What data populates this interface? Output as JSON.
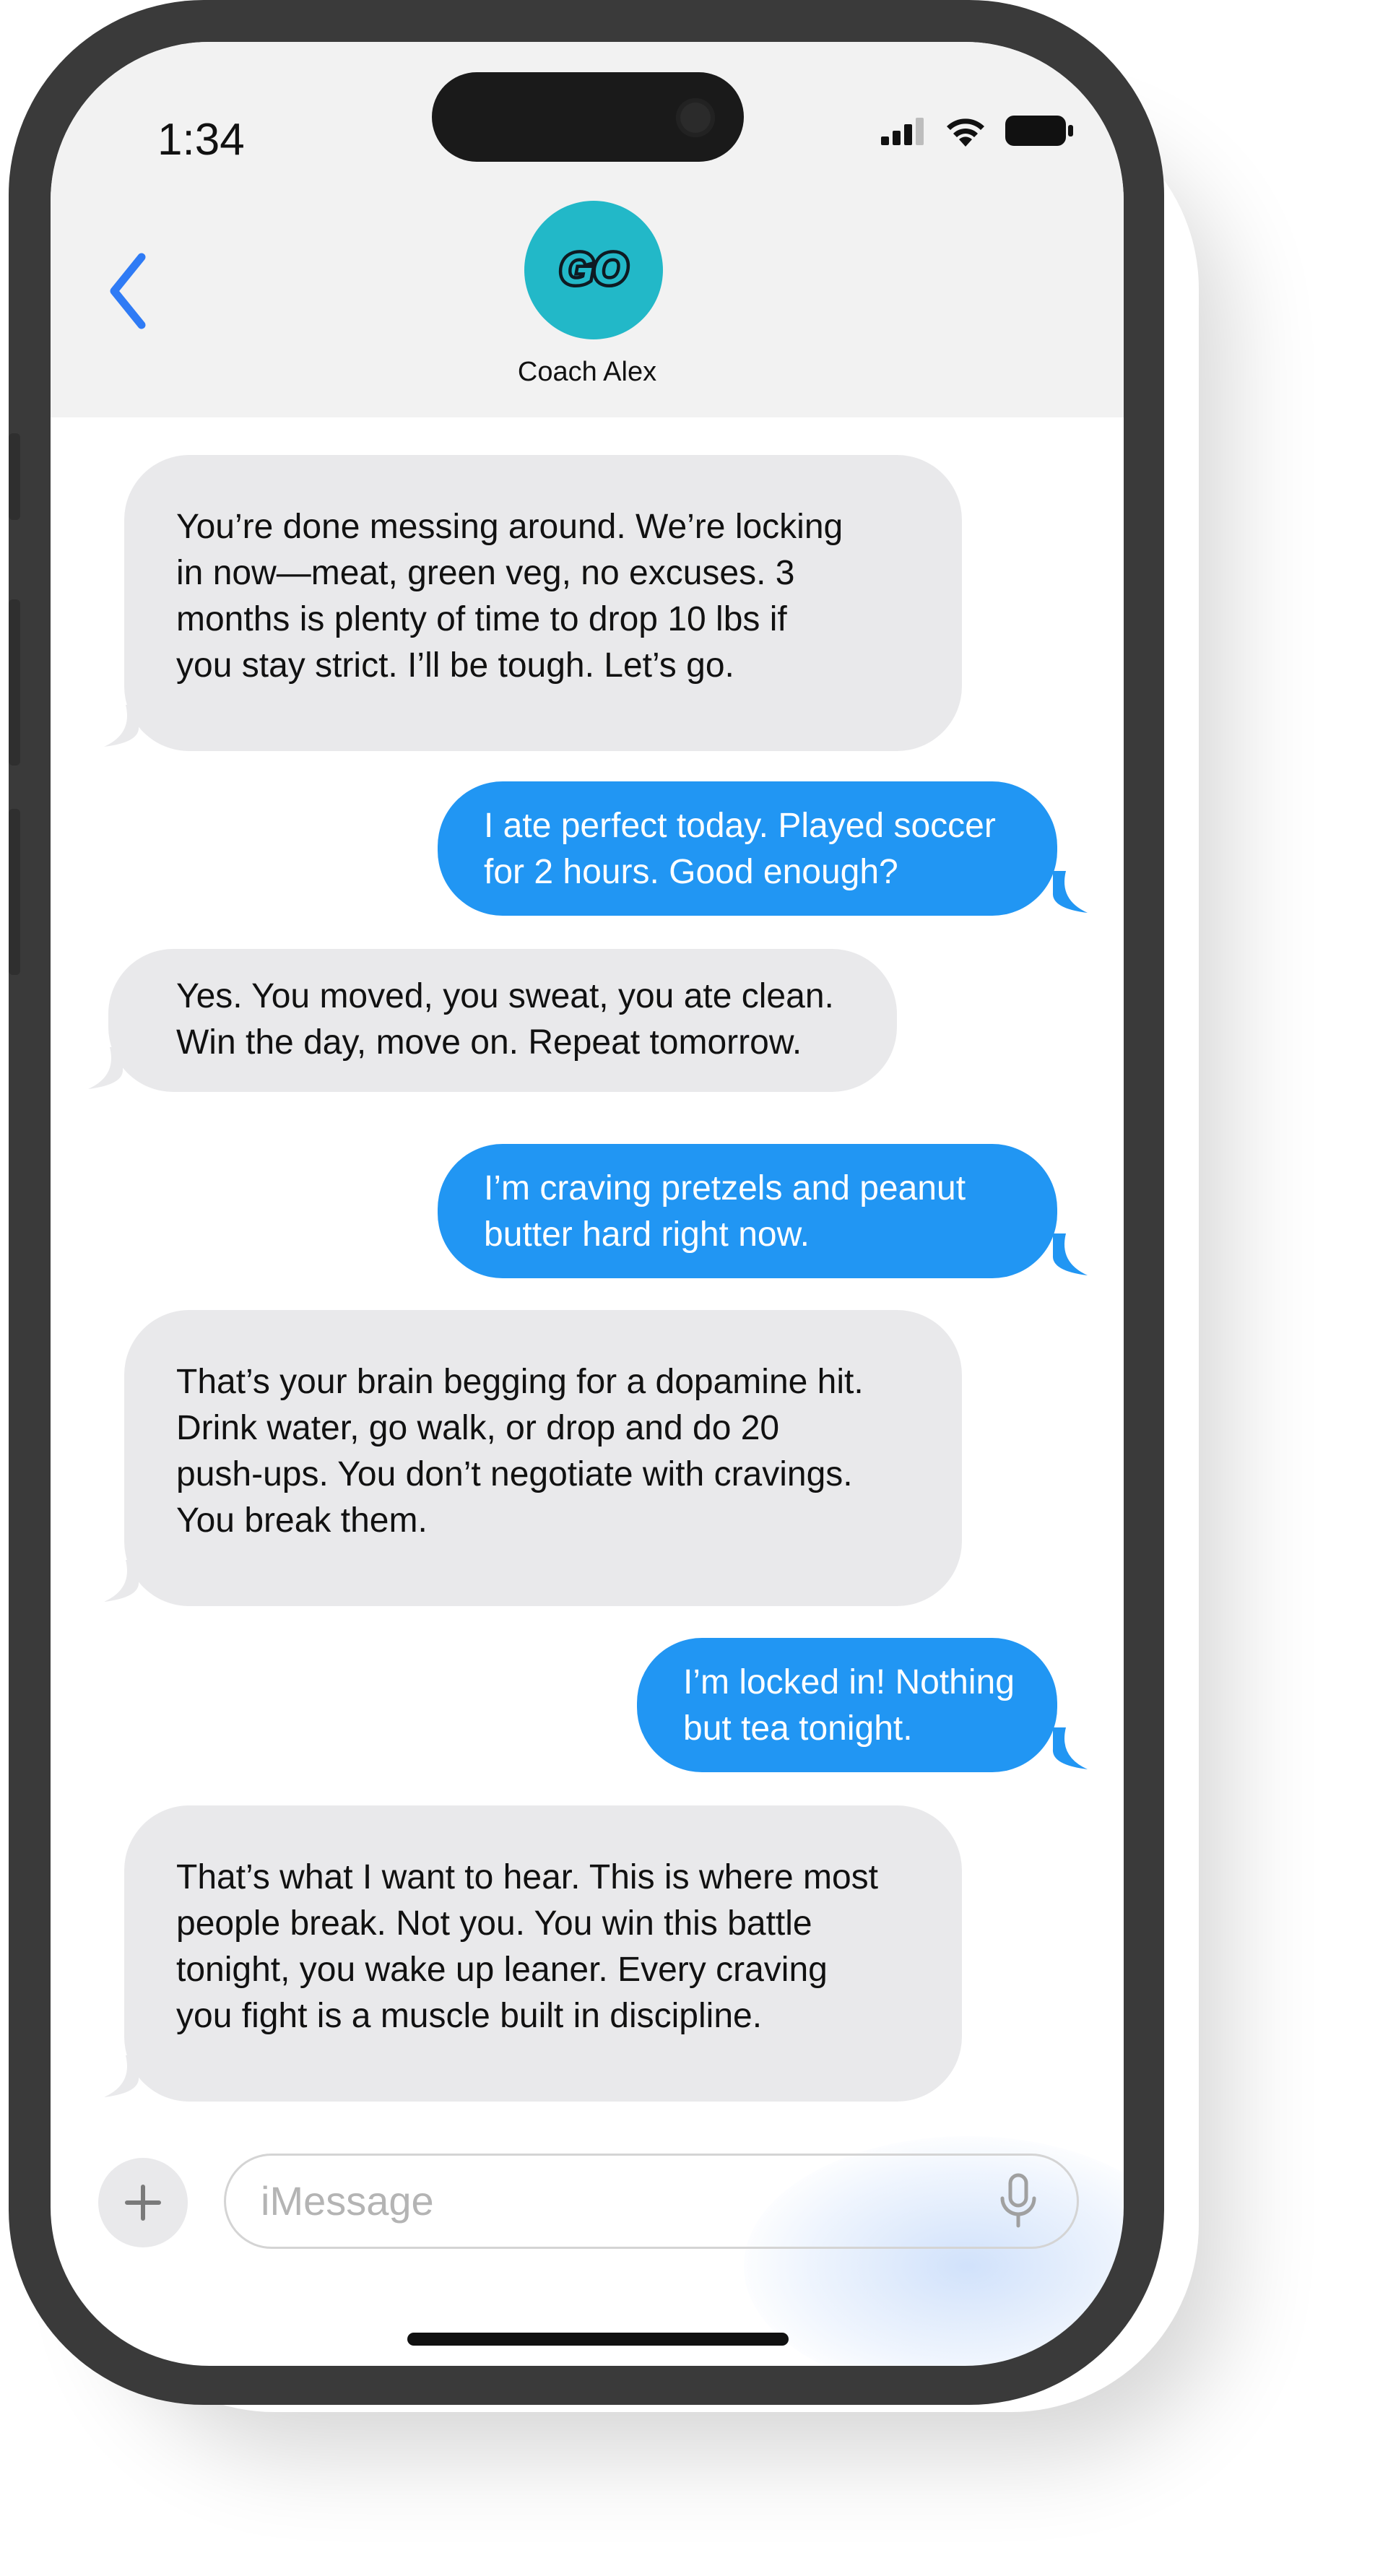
{
  "status_bar": {
    "time": "1:34"
  },
  "header": {
    "contact_name": "Coach Alex",
    "avatar_text": "GO",
    "avatar_color": "#22b8c8"
  },
  "messages": [
    {
      "from": "coach",
      "lines": [
        "You’re done messing around. We’re locking",
        "in now—meat, green veg, no excuses. 3",
        "months is plenty of time to drop 10 lbs if",
        "you stay strict. I’ll be tough. Let’s go."
      ]
    },
    {
      "from": "me",
      "lines": [
        "I ate perfect today. Played soccer",
        "for 2 hours. Good enough?"
      ]
    },
    {
      "from": "coach",
      "lines": [
        "Yes. You moved, you sweat, you ate clean.",
        "Win the day, move on. Repeat tomorrow."
      ]
    },
    {
      "from": "me",
      "lines": [
        "I’m craving pretzels and peanut",
        "butter hard right now."
      ]
    },
    {
      "from": "coach",
      "lines": [
        "That’s your brain begging for a dopamine hit.",
        "Drink water, go walk, or drop and do 20",
        "push-ups. You don’t negotiate with cravings.",
        "You break them."
      ]
    },
    {
      "from": "me",
      "lines": [
        "I’m locked in! Nothing",
        "but tea tonight."
      ]
    },
    {
      "from": "coach",
      "lines": [
        "That’s what I want to hear. This is where most",
        "people break. Not you. You win this battle",
        "tonight, you wake up leaner. Every craving",
        "you fight is a muscle built in discipline."
      ]
    }
  ],
  "composer": {
    "placeholder": "iMessage"
  },
  "icons": {
    "back": "chevron-left-icon",
    "add": "plus-icon",
    "mic": "microphone-icon",
    "signal": "cellular-signal-icon",
    "wifi": "wifi-icon",
    "battery": "battery-icon"
  },
  "colors": {
    "incoming_bubble": "#e9e9eb",
    "outgoing_bubble": "#2196f3",
    "accent": "#2f7bf5"
  }
}
